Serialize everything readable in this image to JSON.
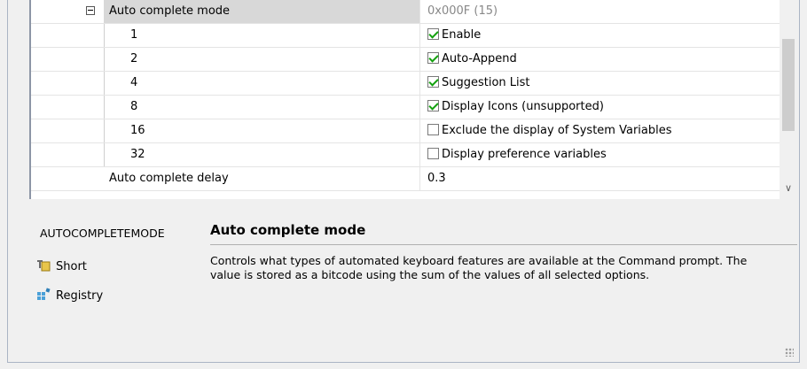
{
  "grid": {
    "header": {
      "name": "Auto complete mode",
      "value": "0x000F (15)"
    },
    "bits": [
      {
        "bit": "1",
        "label": "Enable",
        "checked": true
      },
      {
        "bit": "2",
        "label": "Auto-Append",
        "checked": true
      },
      {
        "bit": "4",
        "label": "Suggestion List",
        "checked": true
      },
      {
        "bit": "8",
        "label": "Display Icons (unsupported)",
        "checked": true
      },
      {
        "bit": "16",
        "label": "Exclude the display of System Variables",
        "checked": false
      },
      {
        "bit": "32",
        "label": "Display preference variables",
        "checked": false
      }
    ],
    "delay": {
      "name": "Auto complete delay",
      "value": "0.3"
    }
  },
  "help": {
    "sysvar": "AUTOCOMPLETEMODE",
    "title": "Auto complete mode",
    "body": "Controls what types of automated keyboard features are available at the Command prompt. The value is stored as a bitcode using the sum of the values of all selected options.",
    "links": [
      {
        "label": "Short",
        "icon": "type-icon"
      },
      {
        "label": "Registry",
        "icon": "registry-icon"
      }
    ]
  },
  "scroll_down_glyph": "∨"
}
